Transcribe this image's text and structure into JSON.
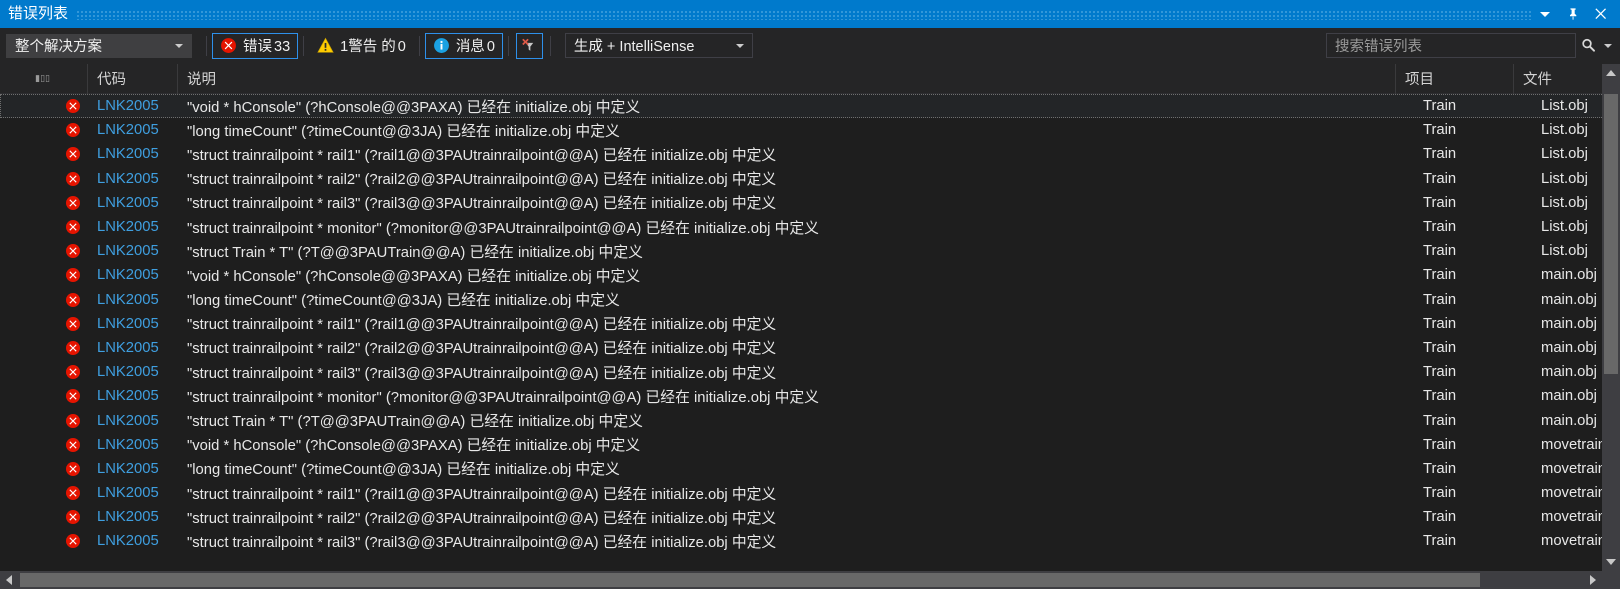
{
  "window": {
    "title": "错误列表",
    "accent_color": "#007acc",
    "buttons": [
      {
        "name": "dropdown",
        "icon": "chevron-down-icon"
      },
      {
        "name": "pin",
        "icon": "pin-icon"
      },
      {
        "name": "close",
        "icon": "close-icon"
      }
    ]
  },
  "toolbar": {
    "scope_selector": {
      "value": "整个解决方案"
    },
    "errors": {
      "label": "错误",
      "count": "33",
      "icon": "error-icon",
      "color": "#e51400",
      "active": true
    },
    "warnings": {
      "label": "1警告 的",
      "count": "0",
      "icon": "warning-icon",
      "color": "#ffcc00",
      "active": false
    },
    "messages": {
      "label": "消息",
      "count": "0",
      "icon": "info-icon",
      "color": "#1ba1e2",
      "active": true
    },
    "filter_button": {
      "icon": "clear-filter-icon",
      "tooltip": ""
    },
    "build_selector": {
      "value": "生成 + IntelliSense"
    },
    "search": {
      "placeholder": "搜索错误列表",
      "value": "",
      "icon": "search-icon"
    }
  },
  "grid": {
    "columns": [
      {
        "key": "sev",
        "label": ""
      },
      {
        "key": "icon",
        "label": ""
      },
      {
        "key": "code",
        "label": "代码"
      },
      {
        "key": "desc",
        "label": "说明"
      },
      {
        "key": "proj",
        "label": "项目"
      },
      {
        "key": "file",
        "label": "文件"
      }
    ],
    "rows": [
      {
        "severity": "error",
        "code": "LNK2005",
        "description": "\"void * hConsole\" (?hConsole@@3PAXA) 已经在 initialize.obj 中定义",
        "project": "Train",
        "file": "List.obj",
        "focused": true
      },
      {
        "severity": "error",
        "code": "LNK2005",
        "description": "\"long timeCount\" (?timeCount@@3JA) 已经在 initialize.obj 中定义",
        "project": "Train",
        "file": "List.obj",
        "focused": false
      },
      {
        "severity": "error",
        "code": "LNK2005",
        "description": "\"struct trainrailpoint * rail1\" (?rail1@@3PAUtrainrailpoint@@A) 已经在 initialize.obj 中定义",
        "project": "Train",
        "file": "List.obj",
        "focused": false
      },
      {
        "severity": "error",
        "code": "LNK2005",
        "description": "\"struct trainrailpoint * rail2\" (?rail2@@3PAUtrainrailpoint@@A) 已经在 initialize.obj 中定义",
        "project": "Train",
        "file": "List.obj",
        "focused": false
      },
      {
        "severity": "error",
        "code": "LNK2005",
        "description": "\"struct trainrailpoint * rail3\" (?rail3@@3PAUtrainrailpoint@@A) 已经在 initialize.obj 中定义",
        "project": "Train",
        "file": "List.obj",
        "focused": false
      },
      {
        "severity": "error",
        "code": "LNK2005",
        "description": "\"struct trainrailpoint * monitor\" (?monitor@@3PAUtrainrailpoint@@A) 已经在 initialize.obj 中定义",
        "project": "Train",
        "file": "List.obj",
        "focused": false
      },
      {
        "severity": "error",
        "code": "LNK2005",
        "description": "\"struct Train * T\" (?T@@3PAUTrain@@A) 已经在 initialize.obj 中定义",
        "project": "Train",
        "file": "List.obj",
        "focused": false
      },
      {
        "severity": "error",
        "code": "LNK2005",
        "description": "\"void * hConsole\" (?hConsole@@3PAXA) 已经在 initialize.obj 中定义",
        "project": "Train",
        "file": "main.obj",
        "focused": false
      },
      {
        "severity": "error",
        "code": "LNK2005",
        "description": "\"long timeCount\" (?timeCount@@3JA) 已经在 initialize.obj 中定义",
        "project": "Train",
        "file": "main.obj",
        "focused": false
      },
      {
        "severity": "error",
        "code": "LNK2005",
        "description": "\"struct trainrailpoint * rail1\" (?rail1@@3PAUtrainrailpoint@@A) 已经在 initialize.obj 中定义",
        "project": "Train",
        "file": "main.obj",
        "focused": false
      },
      {
        "severity": "error",
        "code": "LNK2005",
        "description": "\"struct trainrailpoint * rail2\" (?rail2@@3PAUtrainrailpoint@@A) 已经在 initialize.obj 中定义",
        "project": "Train",
        "file": "main.obj",
        "focused": false
      },
      {
        "severity": "error",
        "code": "LNK2005",
        "description": "\"struct trainrailpoint * rail3\" (?rail3@@3PAUtrainrailpoint@@A) 已经在 initialize.obj 中定义",
        "project": "Train",
        "file": "main.obj",
        "focused": false
      },
      {
        "severity": "error",
        "code": "LNK2005",
        "description": "\"struct trainrailpoint * monitor\" (?monitor@@3PAUtrainrailpoint@@A) 已经在 initialize.obj 中定义",
        "project": "Train",
        "file": "main.obj",
        "focused": false
      },
      {
        "severity": "error",
        "code": "LNK2005",
        "description": "\"struct Train * T\" (?T@@3PAUTrain@@A) 已经在 initialize.obj 中定义",
        "project": "Train",
        "file": "main.obj",
        "focused": false
      },
      {
        "severity": "error",
        "code": "LNK2005",
        "description": "\"void * hConsole\" (?hConsole@@3PAXA) 已经在 initialize.obj 中定义",
        "project": "Train",
        "file": "movetrain",
        "focused": false
      },
      {
        "severity": "error",
        "code": "LNK2005",
        "description": "\"long timeCount\" (?timeCount@@3JA) 已经在 initialize.obj 中定义",
        "project": "Train",
        "file": "movetrain",
        "focused": false
      },
      {
        "severity": "error",
        "code": "LNK2005",
        "description": "\"struct trainrailpoint * rail1\" (?rail1@@3PAUtrainrailpoint@@A) 已经在 initialize.obj 中定义",
        "project": "Train",
        "file": "movetrain",
        "focused": false
      },
      {
        "severity": "error",
        "code": "LNK2005",
        "description": "\"struct trainrailpoint * rail2\" (?rail2@@3PAUtrainrailpoint@@A) 已经在 initialize.obj 中定义",
        "project": "Train",
        "file": "movetrain",
        "focused": false
      },
      {
        "severity": "error",
        "code": "LNK2005",
        "description": "\"struct trainrailpoint * rail3\" (?rail3@@3PAUtrainrailpoint@@A) 已经在 initialize.obj 中定义",
        "project": "Train",
        "file": "movetrain",
        "focused": false
      }
    ]
  }
}
